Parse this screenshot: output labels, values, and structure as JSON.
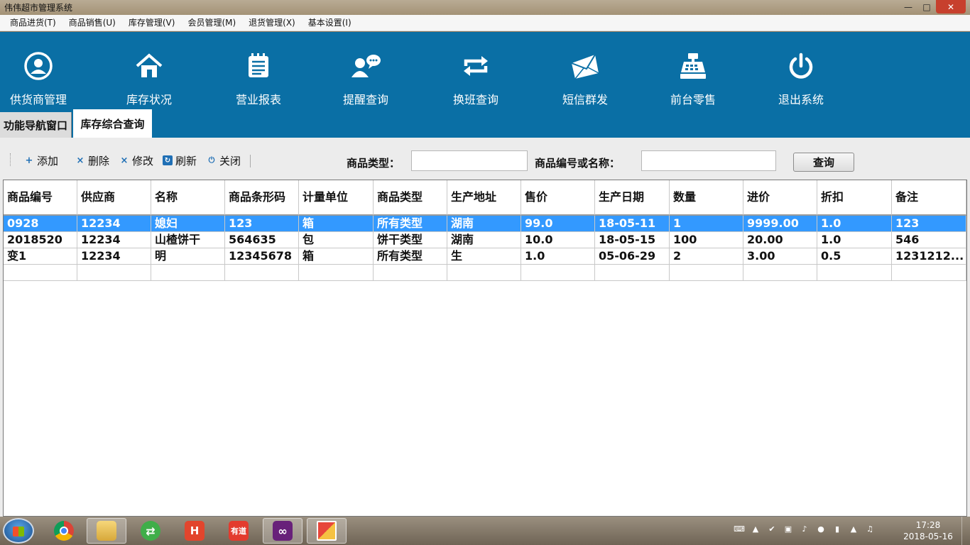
{
  "window": {
    "title": "伟伟超市管理系统"
  },
  "menu": [
    "商品进货(T)",
    "商品销售(U)",
    "库存管理(V)",
    "会员管理(M)",
    "退货管理(X)",
    "基本设置(I)"
  ],
  "tools": [
    {
      "label": "供货商管理",
      "icon": "person-circle-icon"
    },
    {
      "label": "库存状况",
      "icon": "home-icon"
    },
    {
      "label": "营业报表",
      "icon": "notepad-icon"
    },
    {
      "label": "提醒查询",
      "icon": "chat-user-icon"
    },
    {
      "label": "换班查询",
      "icon": "swap-arrows-icon"
    },
    {
      "label": "短信群发",
      "icon": "envelope-icon"
    },
    {
      "label": "前台零售",
      "icon": "cash-register-icon"
    },
    {
      "label": "退出系统",
      "icon": "power-icon"
    }
  ],
  "tabs": [
    "功能导航窗口",
    "库存综合查询"
  ],
  "actions": {
    "add": "添加",
    "delete": "删除",
    "edit": "修改",
    "refresh": "刷新",
    "close": "关闭"
  },
  "filter": {
    "type_label": "商品类型：",
    "type_value": "",
    "name_label": "商品编号或名称：",
    "name_value": "",
    "query": "查询"
  },
  "table": {
    "columns": [
      "商品编号",
      "供应商",
      "名称",
      "商品条形码",
      "计量单位",
      "商品类型",
      "生产地址",
      "售价",
      "生产日期",
      "数量",
      "进价",
      "折扣",
      "备注"
    ],
    "rows": [
      [
        "0928",
        "12234",
        "媳妇",
        "123",
        "箱",
        "所有类型",
        "湖南",
        "99.0",
        "18-05-11",
        "1",
        "9999.00",
        "1.0",
        "123"
      ],
      [
        "2018520",
        "12234",
        "山楂饼干",
        "564635",
        "包",
        "饼干类型",
        "湖南",
        "10.0",
        "18-05-15",
        "100",
        "20.00",
        "1.0",
        "546"
      ],
      [
        "变1",
        "12234",
        "明",
        "12345678",
        "箱",
        "所有类型",
        "生",
        "1.0",
        "05-06-29",
        "2",
        "3.00",
        "0.5",
        "1231212..."
      ]
    ],
    "selected_row": 0
  },
  "taskbar": {
    "time": "17:28",
    "date": "2018-05-16",
    "apps": [
      {
        "name": "chrome-icon"
      },
      {
        "name": "file-explorer-icon"
      },
      {
        "name": "browser-icon"
      },
      {
        "name": "hbuilder-icon",
        "text": "H"
      },
      {
        "name": "youdao-icon",
        "text": "有道"
      },
      {
        "name": "visual-studio-icon"
      },
      {
        "name": "app-window-icon"
      }
    ]
  },
  "colors": {
    "toolbar_bg": "#0a6fa5",
    "selection": "#3399ff"
  }
}
